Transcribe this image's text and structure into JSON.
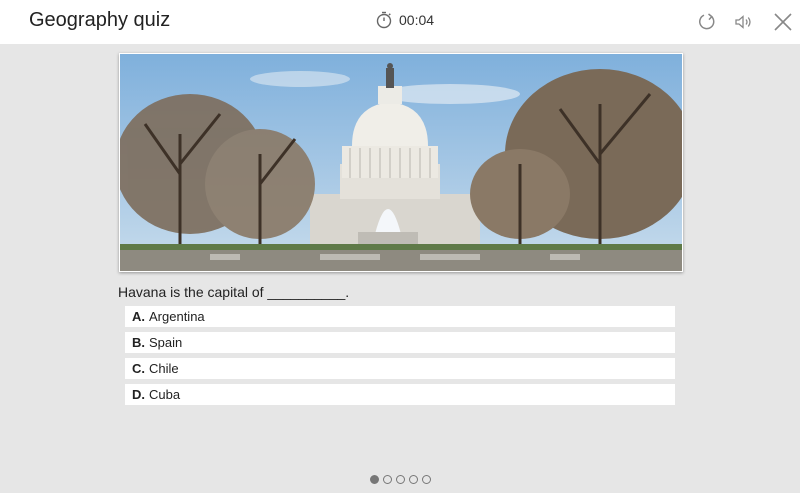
{
  "app": {
    "title": "Geography quiz"
  },
  "timer": {
    "value": "00:04",
    "icon": "stopwatch-icon"
  },
  "toolbar": {
    "restart_icon": "restart-icon",
    "sound_icon": "speaker-icon",
    "close_icon": "close-icon"
  },
  "image": {
    "subject": "capitol-building-photo"
  },
  "question": {
    "text": "Havana is the capital of __________.",
    "answers": [
      {
        "letter": "A.",
        "text": "Argentina"
      },
      {
        "letter": "B.",
        "text": "Spain"
      },
      {
        "letter": "C.",
        "text": "Chile"
      },
      {
        "letter": "D.",
        "text": "Cuba"
      }
    ]
  },
  "pagination": {
    "total": 5,
    "current": 1
  }
}
